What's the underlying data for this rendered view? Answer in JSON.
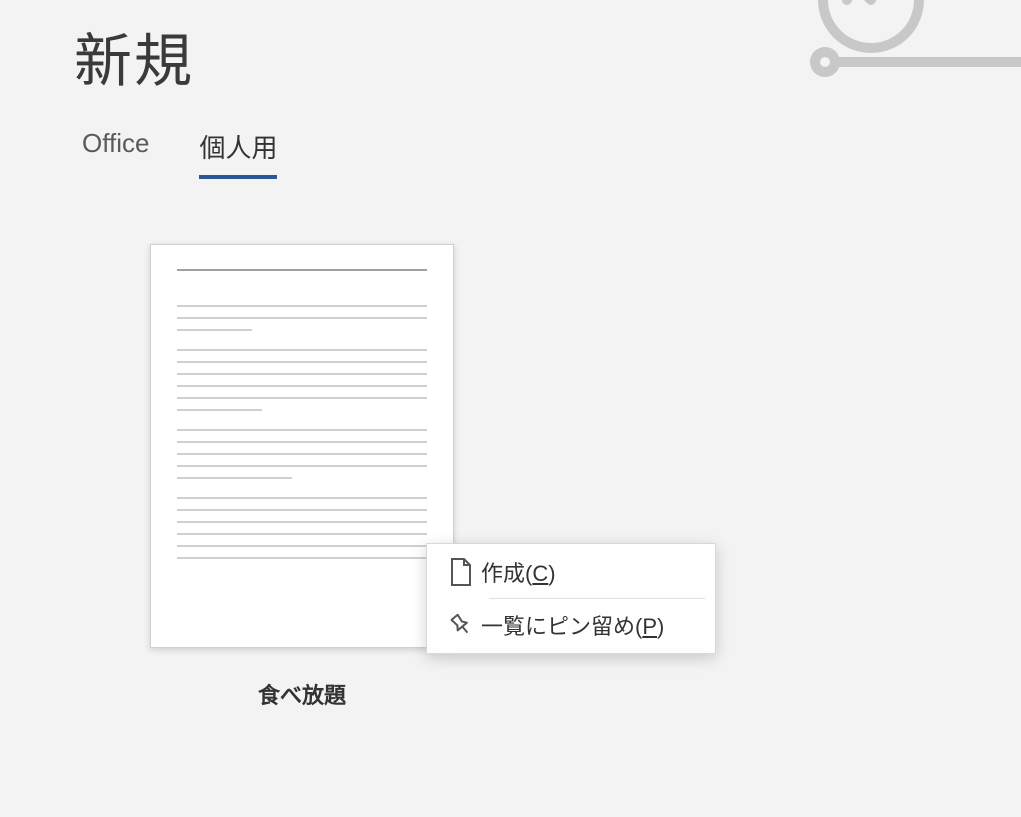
{
  "header": {
    "title": "新規"
  },
  "tabs": {
    "office": "Office",
    "personal": "個人用"
  },
  "template": {
    "label": "食べ放題"
  },
  "context_menu": {
    "create_prefix": "作成(",
    "create_key": "C",
    "create_suffix": ")",
    "pin_prefix": "一覧にピン留め(",
    "pin_key": "P",
    "pin_suffix": ")"
  }
}
